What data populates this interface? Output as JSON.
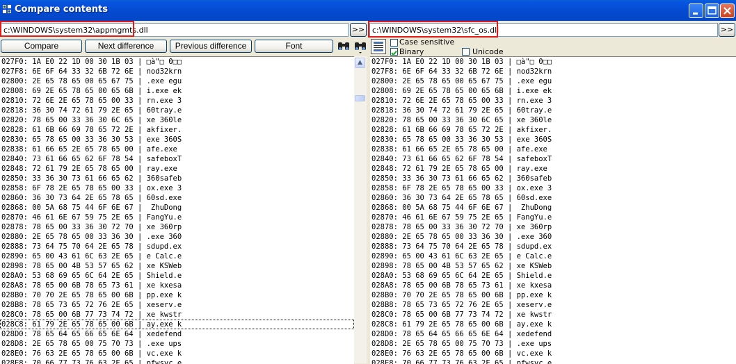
{
  "window": {
    "title": "Compare contents"
  },
  "left": {
    "path": "c:\\WINDOWS\\system32\\appmgmts.dll",
    "browse_label": ">>"
  },
  "right": {
    "path": "c:\\WINDOWS\\system32\\sfc_os.dll",
    "browse_label": ">>"
  },
  "toolbar": {
    "compare_label": "Compare",
    "next_label": "Next difference",
    "prev_label": "Previous difference",
    "font_label": "Font"
  },
  "options": {
    "case_sensitive_label": "Case sensitive",
    "case_sensitive": false,
    "binary_label": "Binary",
    "binary": true,
    "unicode_label": "Unicode",
    "unicode": false
  },
  "icons": [
    "find-icon",
    "find-next-icon",
    "compare-text-icon"
  ],
  "hex_rows": [
    "027F0: 1A E0 22 1D 00 30 1B 03 | □à\"□ 0□□",
    "027F8: 6E 6F 64 33 32 6B 72 6E | nod32krn",
    "02800: 2E 65 78 65 00 65 67 75 | .exe egu",
    "02808: 69 2E 65 78 65 00 65 6B | i.exe ek",
    "02810: 72 6E 2E 65 78 65 00 33 | rn.exe 3",
    "02818: 36 30 74 72 61 79 2E 65 | 60tray.e",
    "02820: 78 65 00 33 36 30 6C 65 | xe 360le",
    "02828: 61 6B 66 69 78 65 72 2E | akfixer.",
    "02830: 65 78 65 00 33 36 30 53 | exe 360S",
    "02838: 61 66 65 2E 65 78 65 00 | afe.exe ",
    "02840: 73 61 66 65 62 6F 78 54 | safeboxT",
    "02848: 72 61 79 2E 65 78 65 00 | ray.exe ",
    "02850: 33 36 30 73 61 66 65 62 | 360safeb",
    "02858: 6F 78 2E 65 78 65 00 33 | ox.exe 3",
    "02860: 36 30 73 64 2E 65 78 65 | 60sd.exe",
    "02868: 00 5A 68 75 44 6F 6E 67 |  ZhuDong",
    "02870: 46 61 6E 67 59 75 2E 65 | FangYu.e",
    "02878: 78 65 00 33 36 30 72 70 | xe 360rp",
    "02880: 2E 65 78 65 00 33 36 30 | .exe 360",
    "02888: 73 64 75 70 64 2E 65 78 | sdupd.ex",
    "02890: 65 00 43 61 6C 63 2E 65 | e Calc.e",
    "02898: 78 65 00 4B 53 57 65 62 | xe KSWeb",
    "028A0: 53 68 69 65 6C 64 2E 65 | Shield.e",
    "028A8: 78 65 00 6B 78 65 73 61 | xe kxesa",
    "028B0: 70 70 2E 65 78 65 00 6B | pp.exe k",
    "028B8: 78 65 73 65 72 76 2E 65 | xeserv.e",
    "028C0: 78 65 00 6B 77 73 74 72 | xe kwstr",
    "028C8: 61 79 2E 65 78 65 00 6B | ay.exe k",
    "028D0: 78 65 64 65 66 65 6E 64 | xedefend",
    "028D8: 2E 65 78 65 00 75 70 73 | .exe ups",
    "028E0: 76 63 2E 65 78 65 00 6B | vc.exe k",
    "028E8: 70 66 77 73 76 63 2E 65 | pfwsvc.e"
  ],
  "current_row": 27
}
